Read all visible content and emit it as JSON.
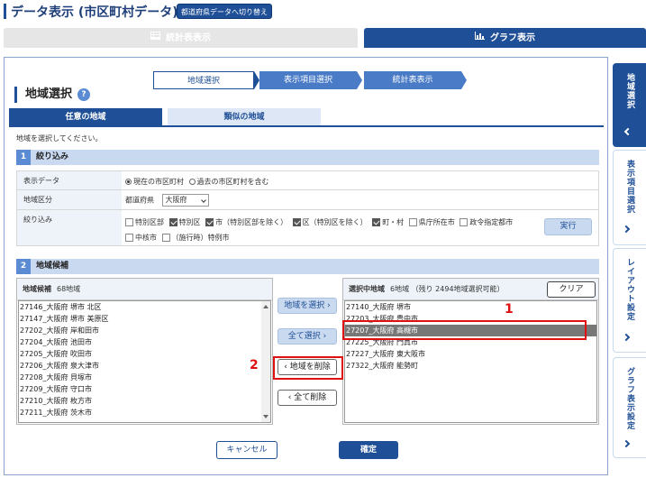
{
  "header": {
    "title": "データ表示 (市区町村データ)",
    "switch_label": "都道府県データへ切り替え"
  },
  "top_tabs": [
    {
      "label": "統計表表示",
      "icon": "table-icon",
      "active": false
    },
    {
      "label": "グラフ表示",
      "icon": "bar-chart-icon",
      "active": true
    }
  ],
  "steps": [
    "地域選択",
    "表示項目選択",
    "統計表表示"
  ],
  "section_title": "地域選択",
  "sub_tabs": [
    "任意の地域",
    "類似の地域"
  ],
  "instruction": "地域を選択してください。",
  "filter": {
    "num": "1",
    "title": "絞り込み",
    "data_label": "表示データ",
    "radio_current": "現在の市区町村",
    "radio_past": "過去の市区町村を含む",
    "area_label": "地域区分",
    "pref_label": "都道府県",
    "pref_value": "大阪府",
    "narrow_label": "絞り込み",
    "checks": [
      {
        "label": "特別区部",
        "checked": false
      },
      {
        "label": "特別区",
        "checked": true
      },
      {
        "label": "市（特別区部を除く）",
        "checked": true
      },
      {
        "label": "区（特別区を除く）",
        "checked": true
      },
      {
        "label": "町・村",
        "checked": true
      },
      {
        "label": "県庁所在市",
        "checked": false
      },
      {
        "label": "政令指定都市",
        "checked": false
      },
      {
        "label": "中核市",
        "checked": false
      },
      {
        "label": "（施行時）特例市",
        "checked": false
      }
    ],
    "exec_label": "実行"
  },
  "candidates": {
    "num": "2",
    "title": "地域候補",
    "list_title": "地域候補",
    "count": "68地域",
    "items": [
      "27146_大阪府 堺市 北区",
      "27147_大阪府 堺市 美原区",
      "27202_大阪府 岸和田市",
      "27204_大阪府 池田市",
      "27205_大阪府 吹田市",
      "27206_大阪府 泉大津市",
      "27208_大阪府 貝塚市",
      "27209_大阪府 守口市",
      "27210_大阪府 枚方市",
      "27211_大阪府 茨木市"
    ]
  },
  "selected": {
    "title": "選択中地域",
    "count": "6地域",
    "remaining": "（残り 2494地域選択可能）",
    "clear_label": "クリア",
    "items": [
      "27140_大阪府 堺市",
      "27203_大阪府 豊中市",
      "27207_大阪府 高槻市",
      "27225_大阪府 門真市",
      "27227_大阪府 東大阪市",
      "27322_大阪府 能勢町"
    ],
    "selected_index": 2
  },
  "mid_buttons": {
    "select": "地域を選択",
    "select_all": "全て選択",
    "remove": "地域を削除",
    "remove_all": "全て削除"
  },
  "annotations": {
    "one": "1",
    "two": "2",
    "color": "#e01010"
  },
  "footer": {
    "cancel": "キャンセル",
    "ok": "確定"
  },
  "side_nav": [
    {
      "label": "地域選択",
      "active": true,
      "chevron": "left"
    },
    {
      "label": "表示項目選択",
      "active": false,
      "chevron": "right"
    },
    {
      "label": "レイアウト設定",
      "active": false,
      "chevron": "right"
    },
    {
      "label": "グラフ表示設定",
      "active": false,
      "chevron": "right"
    }
  ],
  "colors": {
    "primary": "#1f4f96",
    "accent": "#4a7bc6",
    "light": "#c9d9ef"
  }
}
